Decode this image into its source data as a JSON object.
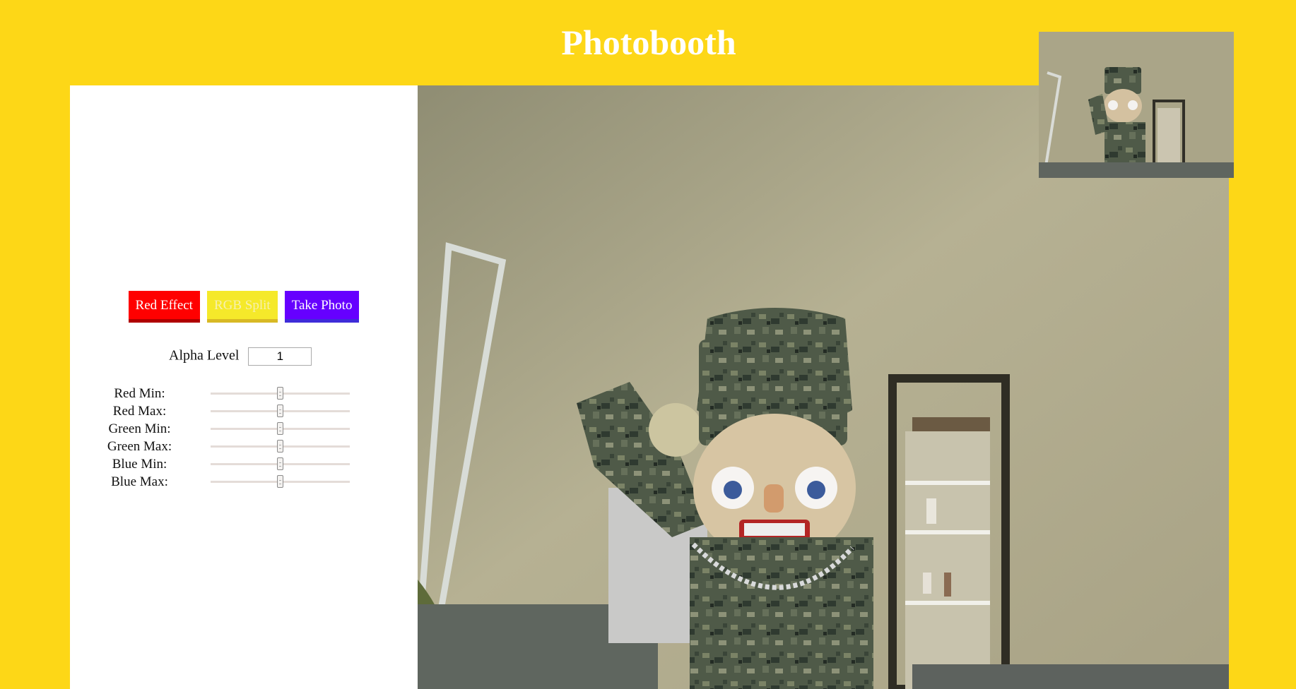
{
  "page": {
    "title": "Photobooth"
  },
  "buttons": {
    "red_effect": "Red Effect",
    "rgb_split": "RGB Split",
    "take_photo": "Take Photo"
  },
  "alpha": {
    "label": "Alpha Level",
    "value": "1"
  },
  "sliders": [
    {
      "label": "Red Min:",
      "value": 0.5
    },
    {
      "label": "Red Max:",
      "value": 0.5
    },
    {
      "label": "Green Min:",
      "value": 0.5
    },
    {
      "label": "Green Max:",
      "value": 0.5
    },
    {
      "label": "Blue Min:",
      "value": 0.5
    },
    {
      "label": "Blue Max:",
      "value": 0.5
    }
  ],
  "colors": {
    "background": "#fdd717",
    "red_button": "#ff0000",
    "yellow_button": "#f5e92a",
    "purple_button": "#6600ff"
  }
}
